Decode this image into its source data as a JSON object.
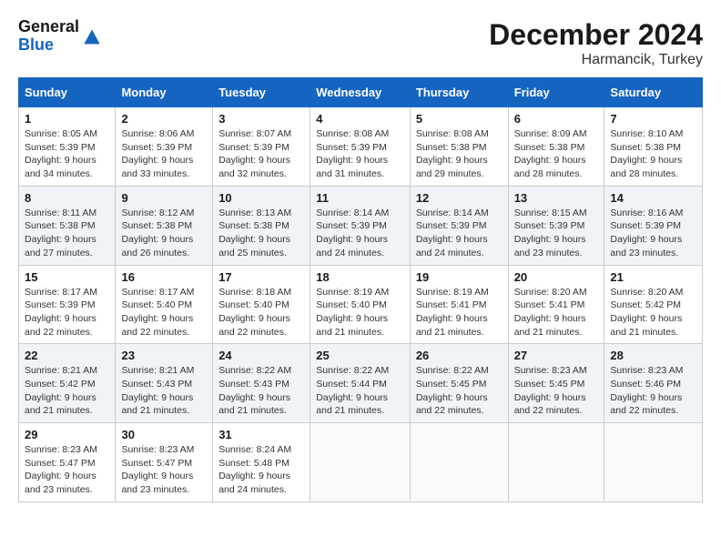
{
  "header": {
    "logo_general": "General",
    "logo_blue": "Blue",
    "month_title": "December 2024",
    "location": "Harmancik, Turkey"
  },
  "calendar": {
    "days_of_week": [
      "Sunday",
      "Monday",
      "Tuesday",
      "Wednesday",
      "Thursday",
      "Friday",
      "Saturday"
    ],
    "weeks": [
      [
        {
          "day": "1",
          "sunrise": "8:05 AM",
          "sunset": "5:39 PM",
          "daylight": "9 hours and 34 minutes."
        },
        {
          "day": "2",
          "sunrise": "8:06 AM",
          "sunset": "5:39 PM",
          "daylight": "9 hours and 33 minutes."
        },
        {
          "day": "3",
          "sunrise": "8:07 AM",
          "sunset": "5:39 PM",
          "daylight": "9 hours and 32 minutes."
        },
        {
          "day": "4",
          "sunrise": "8:08 AM",
          "sunset": "5:39 PM",
          "daylight": "9 hours and 31 minutes."
        },
        {
          "day": "5",
          "sunrise": "8:08 AM",
          "sunset": "5:38 PM",
          "daylight": "9 hours and 29 minutes."
        },
        {
          "day": "6",
          "sunrise": "8:09 AM",
          "sunset": "5:38 PM",
          "daylight": "9 hours and 28 minutes."
        },
        {
          "day": "7",
          "sunrise": "8:10 AM",
          "sunset": "5:38 PM",
          "daylight": "9 hours and 28 minutes."
        }
      ],
      [
        {
          "day": "8",
          "sunrise": "8:11 AM",
          "sunset": "5:38 PM",
          "daylight": "9 hours and 27 minutes."
        },
        {
          "day": "9",
          "sunrise": "8:12 AM",
          "sunset": "5:38 PM",
          "daylight": "9 hours and 26 minutes."
        },
        {
          "day": "10",
          "sunrise": "8:13 AM",
          "sunset": "5:38 PM",
          "daylight": "9 hours and 25 minutes."
        },
        {
          "day": "11",
          "sunrise": "8:14 AM",
          "sunset": "5:39 PM",
          "daylight": "9 hours and 24 minutes."
        },
        {
          "day": "12",
          "sunrise": "8:14 AM",
          "sunset": "5:39 PM",
          "daylight": "9 hours and 24 minutes."
        },
        {
          "day": "13",
          "sunrise": "8:15 AM",
          "sunset": "5:39 PM",
          "daylight": "9 hours and 23 minutes."
        },
        {
          "day": "14",
          "sunrise": "8:16 AM",
          "sunset": "5:39 PM",
          "daylight": "9 hours and 23 minutes."
        }
      ],
      [
        {
          "day": "15",
          "sunrise": "8:17 AM",
          "sunset": "5:39 PM",
          "daylight": "9 hours and 22 minutes."
        },
        {
          "day": "16",
          "sunrise": "8:17 AM",
          "sunset": "5:40 PM",
          "daylight": "9 hours and 22 minutes."
        },
        {
          "day": "17",
          "sunrise": "8:18 AM",
          "sunset": "5:40 PM",
          "daylight": "9 hours and 22 minutes."
        },
        {
          "day": "18",
          "sunrise": "8:19 AM",
          "sunset": "5:40 PM",
          "daylight": "9 hours and 21 minutes."
        },
        {
          "day": "19",
          "sunrise": "8:19 AM",
          "sunset": "5:41 PM",
          "daylight": "9 hours and 21 minutes."
        },
        {
          "day": "20",
          "sunrise": "8:20 AM",
          "sunset": "5:41 PM",
          "daylight": "9 hours and 21 minutes."
        },
        {
          "day": "21",
          "sunrise": "8:20 AM",
          "sunset": "5:42 PM",
          "daylight": "9 hours and 21 minutes."
        }
      ],
      [
        {
          "day": "22",
          "sunrise": "8:21 AM",
          "sunset": "5:42 PM",
          "daylight": "9 hours and 21 minutes."
        },
        {
          "day": "23",
          "sunrise": "8:21 AM",
          "sunset": "5:43 PM",
          "daylight": "9 hours and 21 minutes."
        },
        {
          "day": "24",
          "sunrise": "8:22 AM",
          "sunset": "5:43 PM",
          "daylight": "9 hours and 21 minutes."
        },
        {
          "day": "25",
          "sunrise": "8:22 AM",
          "sunset": "5:44 PM",
          "daylight": "9 hours and 21 minutes."
        },
        {
          "day": "26",
          "sunrise": "8:22 AM",
          "sunset": "5:45 PM",
          "daylight": "9 hours and 22 minutes."
        },
        {
          "day": "27",
          "sunrise": "8:23 AM",
          "sunset": "5:45 PM",
          "daylight": "9 hours and 22 minutes."
        },
        {
          "day": "28",
          "sunrise": "8:23 AM",
          "sunset": "5:46 PM",
          "daylight": "9 hours and 22 minutes."
        }
      ],
      [
        {
          "day": "29",
          "sunrise": "8:23 AM",
          "sunset": "5:47 PM",
          "daylight": "9 hours and 23 minutes."
        },
        {
          "day": "30",
          "sunrise": "8:23 AM",
          "sunset": "5:47 PM",
          "daylight": "9 hours and 23 minutes."
        },
        {
          "day": "31",
          "sunrise": "8:24 AM",
          "sunset": "5:48 PM",
          "daylight": "9 hours and 24 minutes."
        },
        null,
        null,
        null,
        null
      ]
    ],
    "labels": {
      "sunrise": "Sunrise:",
      "sunset": "Sunset:",
      "daylight": "Daylight:"
    }
  }
}
